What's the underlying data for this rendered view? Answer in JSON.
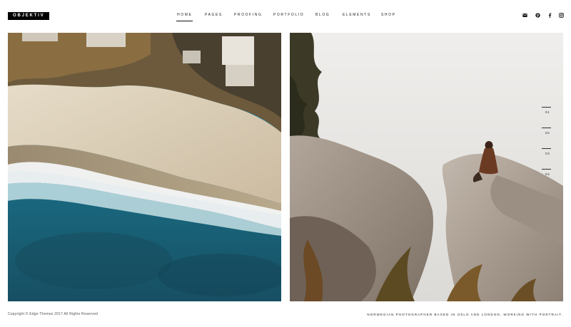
{
  "header": {
    "logo": "OBJEKTIV",
    "nav": [
      "HOME",
      "PAGES",
      "PROOFING",
      "PORTFOLIO",
      "BLOG",
      "ELEMENTS",
      "SHOP"
    ],
    "active_nav": "HOME",
    "social_icons": [
      "envelope-icon",
      "pinterest-icon",
      "facebook-icon",
      "instagram-icon"
    ]
  },
  "gallery": {
    "images": [
      "aerial-beach-photo",
      "rock-cliff-woman-photo"
    ],
    "slide_numbers": [
      "01",
      "02",
      "03",
      "04"
    ]
  },
  "footer": {
    "copyright": "Copyright © Edge Themes 2017 All Rights Reserved",
    "tagline": "NORWEGIAN PHOTOGRAPHER BASED IN OSLO AND LONDON, WORKING WITH PORTRAIT."
  }
}
